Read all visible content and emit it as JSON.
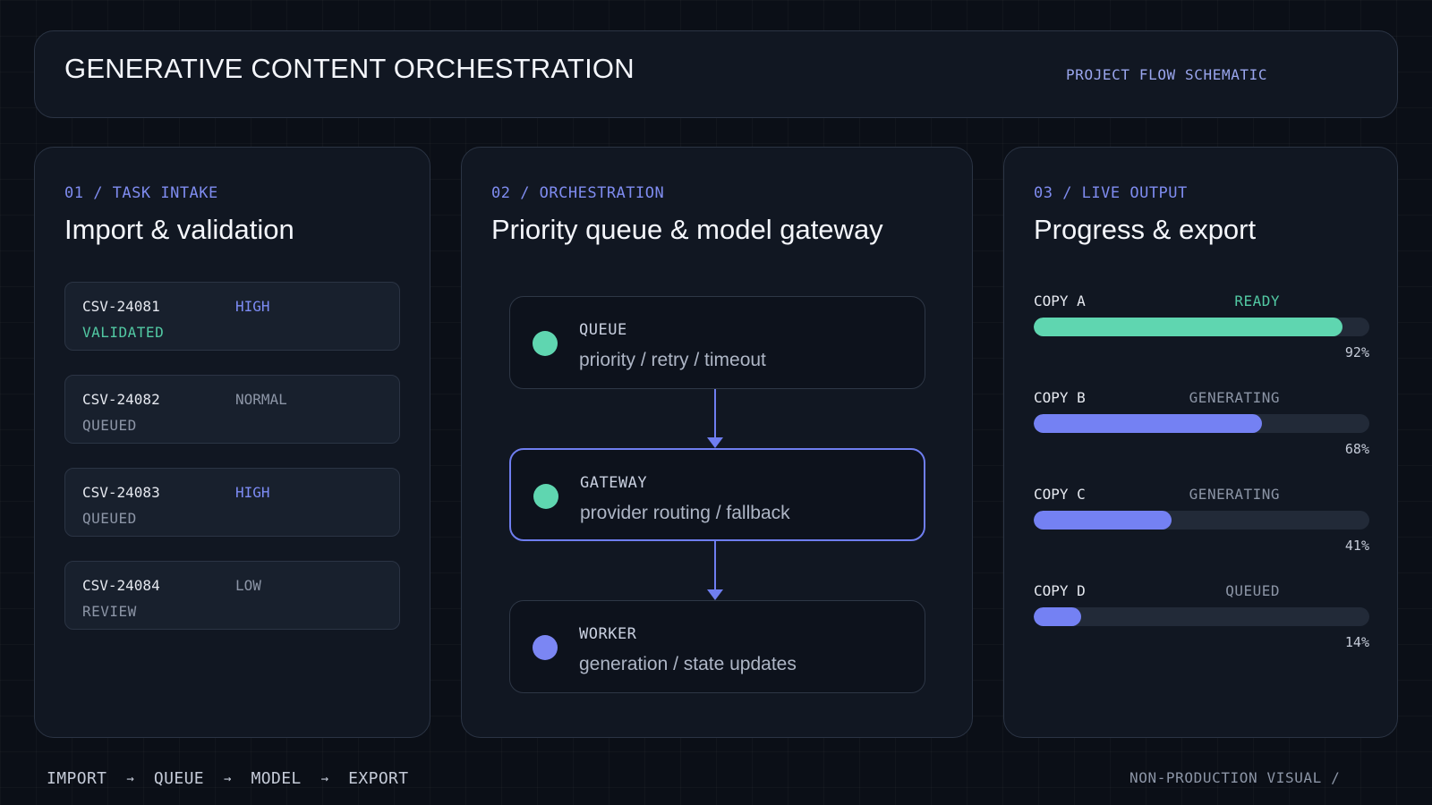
{
  "header": {
    "title": "GENERATIVE CONTENT ORCHESTRATION",
    "subtitle": "PROJECT FLOW SCHEMATIC"
  },
  "intake": {
    "label": "01 / TASK INTAKE",
    "title": "Import & validation",
    "tasks": [
      {
        "id": "CSV-24081",
        "priority": "HIGH",
        "status": "VALIDATED"
      },
      {
        "id": "CSV-24082",
        "priority": "NORMAL",
        "status": "QUEUED"
      },
      {
        "id": "CSV-24083",
        "priority": "HIGH",
        "status": "QUEUED"
      },
      {
        "id": "CSV-24084",
        "priority": "LOW",
        "status": "REVIEW"
      }
    ]
  },
  "orchestration": {
    "label": "02 / ORCHESTRATION",
    "title": "Priority queue & model gateway",
    "nodes": [
      {
        "name": "QUEUE",
        "desc": "priority / retry / timeout",
        "dot_color": "#5fd6b0"
      },
      {
        "name": "GATEWAY",
        "desc": "provider routing / fallback",
        "dot_color": "#5fd6b0"
      },
      {
        "name": "WORKER",
        "desc": "generation / state updates",
        "dot_color": "#7b86f3"
      }
    ]
  },
  "output": {
    "label": "03 / LIVE OUTPUT",
    "title": "Progress & export",
    "items": [
      {
        "name": "COPY A",
        "status": "READY",
        "percent": 92,
        "percent_label": "92%",
        "color": "#5fd6b0"
      },
      {
        "name": "COPY B",
        "status": "GENERATING",
        "percent": 68,
        "percent_label": "68%",
        "color": "#7481f3"
      },
      {
        "name": "COPY C",
        "status": "GENERATING",
        "percent": 41,
        "percent_label": "41%",
        "color": "#7481f3"
      },
      {
        "name": "COPY D",
        "status": "QUEUED",
        "percent": 14,
        "percent_label": "14%",
        "color": "#7481f3"
      }
    ]
  },
  "footer": {
    "steps": [
      "IMPORT",
      "QUEUE",
      "MODEL",
      "EXPORT"
    ],
    "separator": "→",
    "note": "NON-PRODUCTION VISUAL /"
  },
  "colors": {
    "accent": "#6f7ef0",
    "ready": "#52c9a3",
    "background": "#0b0f17"
  }
}
